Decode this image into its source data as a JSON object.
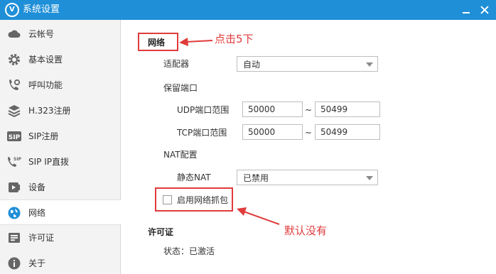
{
  "window": {
    "title": "系统设置",
    "logo_text": "V",
    "accent_color": "#1f8fd8"
  },
  "sidebar": {
    "items": [
      {
        "label": "云帐号",
        "icon": "cloud-icon"
      },
      {
        "label": "基本设置",
        "icon": "gear-icon"
      },
      {
        "label": "呼叫功能",
        "icon": "phone-settings-icon"
      },
      {
        "label": "H.323注册",
        "icon": "stack-layers-icon"
      },
      {
        "label": "SIP注册",
        "icon": "sip-icon"
      },
      {
        "label": "SIP IP直拨",
        "icon": "sip-phone-icon"
      },
      {
        "label": "设备",
        "icon": "video-device-icon"
      },
      {
        "label": "网络",
        "icon": "globe-icon",
        "active": true
      },
      {
        "label": "许可证",
        "icon": "license-icon"
      },
      {
        "label": "关于",
        "icon": "info-icon"
      }
    ]
  },
  "network": {
    "section_title": "网络",
    "adapter_label": "适配器",
    "adapter_value": "自动",
    "reserved_ports_label": "保留端口",
    "udp_label": "UDP端口范围",
    "udp_from": "50000",
    "udp_to": "50499",
    "tcp_label": "TCP端口范围",
    "tcp_from": "50000",
    "tcp_to": "50499",
    "range_separator": "~",
    "nat_label": "NAT配置",
    "static_nat_label": "静态NAT",
    "static_nat_value": "已禁用",
    "capture_label": "启用网络抓包",
    "capture_checked": false
  },
  "license": {
    "section_title": "许可证",
    "status_text": "状态：已激活"
  },
  "annotations": {
    "click_hint": "点击5下",
    "default_hint": "默认没有",
    "color": "#e03b3b"
  }
}
